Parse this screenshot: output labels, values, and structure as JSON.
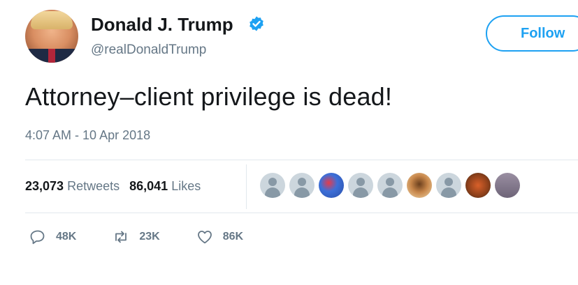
{
  "tweet": {
    "author": {
      "display_name": "Donald J. Trump",
      "handle": "@realDonaldTrump",
      "verified": true
    },
    "follow_label": "Follow",
    "text": "Attorney–client privilege is dead!",
    "timestamp": "4:07 AM - 10 Apr 2018",
    "stats": {
      "retweets_count": "23,073",
      "retweets_label": "Retweets",
      "likes_count": "86,041",
      "likes_label": "Likes"
    },
    "actions": {
      "reply_count": "48K",
      "retweet_count": "23K",
      "like_count": "86K"
    }
  },
  "colors": {
    "accent": "#1da1f2",
    "secondary_text": "#657786",
    "divider": "#e1e8ed"
  },
  "icons": [
    "verified-badge-icon",
    "reply-icon",
    "retweet-icon",
    "like-icon"
  ]
}
